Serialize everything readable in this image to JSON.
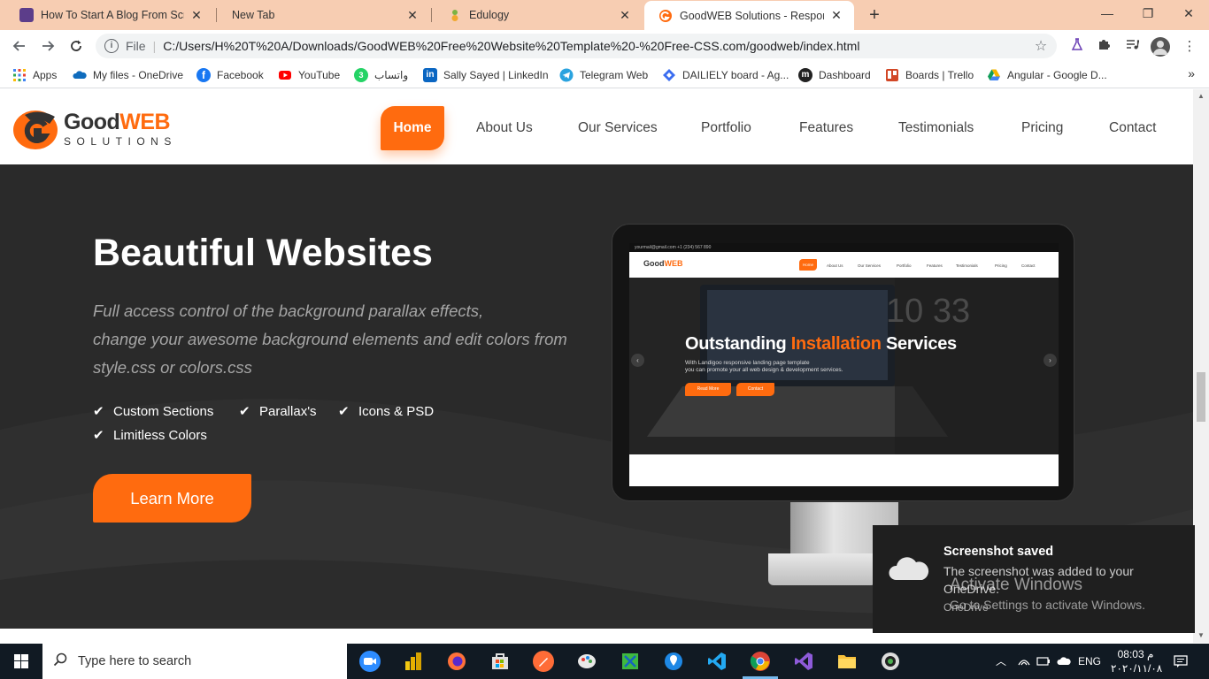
{
  "browser": {
    "tabs": [
      {
        "title": "How To Start A Blog From Scratch",
        "icon": "blog-favicon",
        "color": "#5c3d8a",
        "active": false
      },
      {
        "title": "New Tab",
        "icon": "newtab-favicon",
        "color": "",
        "active": false
      },
      {
        "title": "Edulogy",
        "icon": "edulogy-favicon",
        "color": "#7cb342",
        "active": false
      },
      {
        "title": "GoodWEB Solutions - Responsive",
        "icon": "goodweb-favicon",
        "color": "#ff6b0f",
        "active": true
      }
    ],
    "window_controls": {
      "minimize": "—",
      "restore": "❐",
      "close": "✕"
    },
    "address": {
      "scheme_label": "File",
      "url": "C:/Users/H%20T%20A/Downloads/GoodWEB%20Free%20Website%20Template%20-%20Free-CSS.com/goodweb/index.html"
    },
    "bookmarks": [
      {
        "label": "Apps",
        "icon": "apps-grid-icon",
        "color": "#4285f4"
      },
      {
        "label": "My files - OneDrive",
        "icon": "onedrive-icon",
        "color": "#0f6cbd"
      },
      {
        "label": "Facebook",
        "icon": "facebook-icon",
        "color": "#1877f2"
      },
      {
        "label": "YouTube",
        "icon": "youtube-icon",
        "color": "#ff0000"
      },
      {
        "label": "واتساب",
        "icon": "whatsapp-icon",
        "color": "#25d366"
      },
      {
        "label": "Sally Sayed | LinkedIn",
        "icon": "linkedin-icon",
        "color": "#0a66c2"
      },
      {
        "label": "Telegram Web",
        "icon": "telegram-icon",
        "color": "#2aa3df"
      },
      {
        "label": "DAILIELY board - Ag...",
        "icon": "diamond-icon",
        "color": "#3b6df0"
      },
      {
        "label": "Dashboard",
        "icon": "dashboard-icon",
        "color": "#222222"
      },
      {
        "label": "Boards | Trello",
        "icon": "trello-icon",
        "color": "#d24726"
      },
      {
        "label": "Angular - Google D...",
        "icon": "google-drive-icon",
        "color": "#f4b400"
      }
    ]
  },
  "site": {
    "logo": {
      "word_a": "Good",
      "word_b": "WEB",
      "sub": "SOLUTIONS"
    },
    "nav": [
      "Home",
      "About Us",
      "Our Services",
      "Portfolio",
      "Features",
      "Testimonials",
      "Pricing",
      "Contact"
    ],
    "accent": "#ff6b0f",
    "hero": {
      "title": "Beautiful Websites",
      "desc_lines": [
        "Full access control of the background parallax effects,",
        "change your awesome background elements and edit colors from",
        "style.css or colors.css"
      ],
      "features": [
        "Custom Sections",
        "Parallax's",
        "Icons & PSD",
        "Limitless Colors"
      ],
      "cta": "Learn More"
    },
    "mockup": {
      "topbar": "yourmail@gmail.com    +1 (234) 567 890",
      "logo_a": "Good",
      "logo_b": "WEB",
      "nav": [
        "Home",
        "About Us",
        "Our Services",
        "Portfolio",
        "Features",
        "Testimonials",
        "Pricing",
        "Contact"
      ],
      "title_a": "Outstanding ",
      "title_b": "Installation",
      "title_c": " Services",
      "desc_1": "With Landigoo responsive landing page template",
      "desc_2": "you can promote your all web design & development services.",
      "btn_1": "Read More",
      "btn_2": "Contact"
    }
  },
  "toast": {
    "title": "Screenshot saved",
    "body": "The screenshot was added to your OneDrive.",
    "source": "OneDrive"
  },
  "watermark": {
    "title": "Activate Windows",
    "subtitle": "Go to Settings to activate Windows."
  },
  "taskbar": {
    "search_placeholder": "Type here to search",
    "apps": [
      {
        "icon": "zoom-icon",
        "color": "#2d8cff"
      },
      {
        "icon": "power-bi-icon",
        "color": "#f2c811"
      },
      {
        "icon": "firefox-icon",
        "color": "#ff7139"
      },
      {
        "icon": "store-icon",
        "color": "#e0e0e0"
      },
      {
        "icon": "postman-icon",
        "color": "#ff6c37"
      },
      {
        "icon": "paint-icon",
        "color": "#e8e8e8"
      },
      {
        "icon": "snip-icon",
        "color": "#3fb93f"
      },
      {
        "icon": "maps-icon",
        "color": "#1e88e5"
      },
      {
        "icon": "vscode-icon",
        "color": "#23a9f2"
      },
      {
        "icon": "chrome-icon",
        "color": "#db4437"
      },
      {
        "icon": "visual-studio-icon",
        "color": "#8e5bd9"
      },
      {
        "icon": "file-explorer-icon",
        "color": "#f8c03a"
      },
      {
        "icon": "camera-icon",
        "color": "#dddddd"
      }
    ],
    "language": "ENG",
    "time": "08:03 م",
    "date": "٢٠٢٠/١١/٠٨"
  }
}
